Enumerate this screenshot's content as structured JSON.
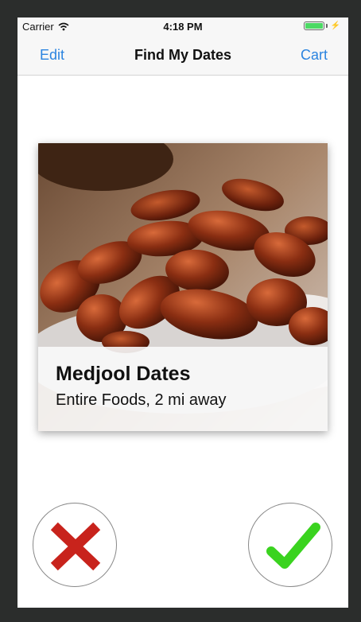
{
  "status_bar": {
    "carrier": "Carrier",
    "time": "4:18 PM"
  },
  "nav": {
    "left_label": "Edit",
    "title": "Find My Dates",
    "right_label": "Cart"
  },
  "card": {
    "image": "dates-photo",
    "title": "Medjool Dates",
    "subtitle": "Entire Foods, 2 mi away"
  },
  "actions": {
    "reject_icon": "x-icon",
    "accept_icon": "checkmark-icon",
    "reject_color": "#c8231c",
    "accept_color": "#3ad31f"
  },
  "colors": {
    "accent": "#2b84e0",
    "battery": "#4cd964"
  }
}
